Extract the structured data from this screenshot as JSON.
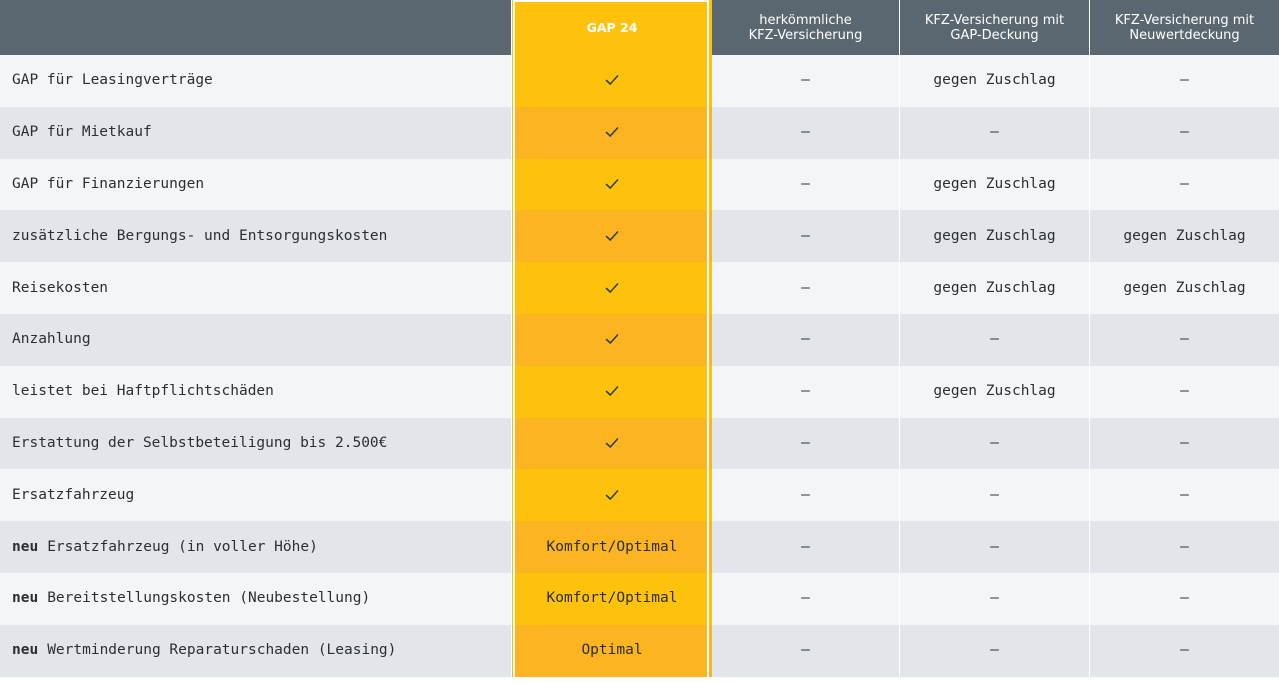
{
  "header": {
    "col_gap": "GAP 24",
    "col_conventional": "herkömmliche\nKFZ-Versicherung",
    "col_gap_cover": "KFZ-Versicherung mit\nGAP-Deckung",
    "col_new_value": "KFZ-Versicherung mit\nNeuwertdeckung"
  },
  "icons": {
    "included": "check-icon"
  },
  "colors": {
    "header_bg": "#5b6770",
    "gap_yellow": "#fec20c",
    "gap_orange": "#fdb421"
  },
  "neu_label": "neu",
  "rows": [
    {
      "feature": "GAP für Leasingverträge",
      "neu": false,
      "gap": "check",
      "conventional": "–",
      "gap_cover": "gegen Zuschlag",
      "new_value": "–"
    },
    {
      "feature": "GAP für Mietkauf",
      "neu": false,
      "gap": "check",
      "conventional": "–",
      "gap_cover": "–",
      "new_value": "–"
    },
    {
      "feature": "GAP für Finanzierungen",
      "neu": false,
      "gap": "check",
      "conventional": "–",
      "gap_cover": "gegen Zuschlag",
      "new_value": "–"
    },
    {
      "feature": "zusätzliche Bergungs- und Entsorgungskosten",
      "neu": false,
      "gap": "check",
      "conventional": "–",
      "gap_cover": "gegen Zuschlag",
      "new_value": "gegen Zuschlag"
    },
    {
      "feature": "Reisekosten",
      "neu": false,
      "gap": "check",
      "conventional": "–",
      "gap_cover": "gegen Zuschlag",
      "new_value": "gegen Zuschlag"
    },
    {
      "feature": "Anzahlung",
      "neu": false,
      "gap": "check",
      "conventional": "–",
      "gap_cover": "–",
      "new_value": "–"
    },
    {
      "feature": "leistet bei Haftpflichtschäden",
      "neu": false,
      "gap": "check",
      "conventional": "–",
      "gap_cover": "gegen Zuschlag",
      "new_value": "–"
    },
    {
      "feature": "Erstattung der Selbstbeteiligung bis 2.500€",
      "neu": false,
      "gap": "check",
      "conventional": "–",
      "gap_cover": "–",
      "new_value": "–"
    },
    {
      "feature": "Ersatzfahrzeug",
      "neu": false,
      "gap": "check",
      "conventional": "–",
      "gap_cover": "–",
      "new_value": "–"
    },
    {
      "feature": "Ersatzfahrzeug (in voller Höhe)",
      "neu": true,
      "gap": "Komfort/Optimal",
      "conventional": "–",
      "gap_cover": "–",
      "new_value": "–"
    },
    {
      "feature": "Bereitstellungskosten (Neubestellung)",
      "neu": true,
      "gap": "Komfort/Optimal",
      "conventional": "–",
      "gap_cover": "–",
      "new_value": "–"
    },
    {
      "feature": "Wertminderung Reparaturschaden (Leasing)",
      "neu": true,
      "gap": "Optimal",
      "conventional": "–",
      "gap_cover": "–",
      "new_value": "–"
    }
  ]
}
